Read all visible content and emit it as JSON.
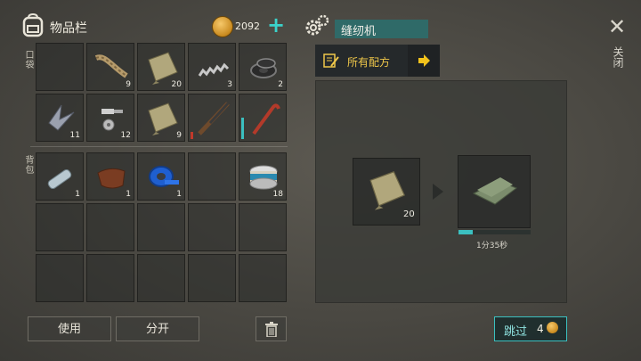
{
  "inventory": {
    "title": "物品栏",
    "coins": "2092",
    "plus": "+",
    "pocket_label": "口袋",
    "backpack_label": "背包",
    "pocket_slots": [
      {
        "item": "empty",
        "qty": ""
      },
      {
        "item": "rope-icon",
        "qty": "9"
      },
      {
        "item": "cloth-icon",
        "qty": "20"
      },
      {
        "item": "spring-icon",
        "qty": "3"
      },
      {
        "item": "washer-icon",
        "qty": "2"
      },
      {
        "item": "metal-scrap-icon",
        "qty": "11"
      },
      {
        "item": "bolts-icon",
        "qty": "12"
      },
      {
        "item": "cloth-icon",
        "qty": "9"
      },
      {
        "item": "rifle-icon",
        "qty": ""
      },
      {
        "item": "crowbar-icon",
        "qty": ""
      }
    ],
    "backpack_slots": [
      {
        "item": "water-bottle-icon",
        "qty": "1"
      },
      {
        "item": "leather-icon",
        "qty": "1"
      },
      {
        "item": "tape-icon",
        "qty": "1"
      },
      {
        "item": "empty",
        "qty": ""
      },
      {
        "item": "canned-fish-icon",
        "qty": "18"
      }
    ],
    "use_label": "使用",
    "split_label": "分开"
  },
  "crafting": {
    "machine_name": "缝纫机",
    "recipes_label": "所有配方",
    "input_qty": "20",
    "progress": 0.2,
    "time": "1分35秒",
    "skip_label": "跳过",
    "skip_cost": "4"
  },
  "close_label": "关闭",
  "close_symbol": "✕",
  "colors": {
    "accent": "#3bc0c0",
    "machine_bar": "#2f6a68",
    "recipe_text": "#f0c84a",
    "coin": "#e0a63a"
  }
}
